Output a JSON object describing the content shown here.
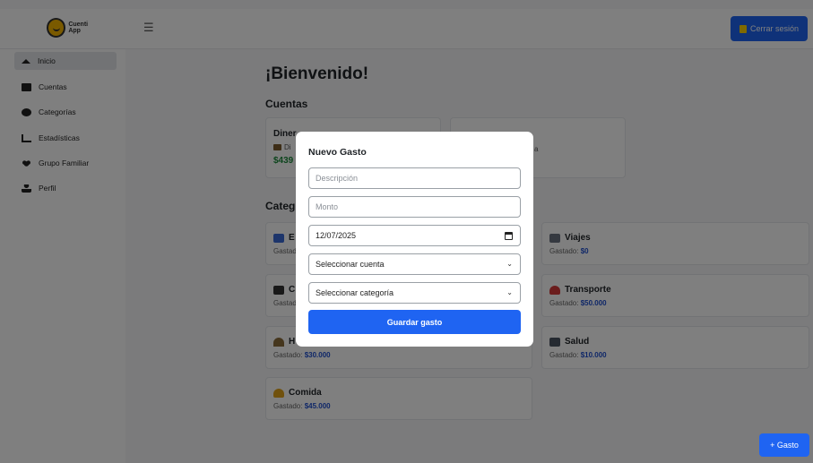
{
  "app": {
    "logo_text": "Cuenti App"
  },
  "header": {
    "menu_icon": "hamburger-icon",
    "logout_label": "Cerrar sesión",
    "logout_icon": "logout-icon"
  },
  "sidebar": {
    "items": [
      {
        "label": "Inicio",
        "icon": "home-icon"
      },
      {
        "label": "Cuentas",
        "icon": "card-icon"
      },
      {
        "label": "Categorías",
        "icon": "pie-icon"
      },
      {
        "label": "Estadísticas",
        "icon": "chart-icon"
      },
      {
        "label": "Grupo Familiar",
        "icon": "users-icon"
      },
      {
        "label": "Perfil",
        "icon": "user-icon"
      }
    ]
  },
  "main": {
    "welcome": "¡Bienvenido!",
    "accounts_heading": "Cuentas",
    "accounts": [
      {
        "title": "Diner",
        "sub": "Di",
        "amount": "$439"
      },
      {
        "title": "",
        "sub": "a",
        "amount": ""
      }
    ],
    "categories_heading": "Categ",
    "categories": [
      {
        "name": "E",
        "spent_label": "Gastad",
        "spent": ""
      },
      {
        "name": "Viajes",
        "spent_label": "Gastado:",
        "spent": "$0"
      },
      {
        "name": "C",
        "spent_label": "Gastad",
        "spent": ""
      },
      {
        "name": "Transporte",
        "spent_label": "Gastado:",
        "spent": "$50.000"
      },
      {
        "name": "H",
        "spent_label": "Gastado:",
        "spent": "$30.000"
      },
      {
        "name": "Salud",
        "spent_label": "Gastado:",
        "spent": "$10.000"
      },
      {
        "name": "Comida",
        "spent_label": "Gastado:",
        "spent": "$45.000"
      }
    ]
  },
  "modal": {
    "title": "Nuevo Gasto",
    "description_placeholder": "Descripción",
    "amount_placeholder": "Monto",
    "date_value": "12/07/2025",
    "account_select": "Seleccionar cuenta",
    "category_select": "Seleccionar categoría",
    "save_label": "Guardar gasto"
  },
  "fab": {
    "label": "+ Gasto"
  },
  "colors": {
    "primary": "#1f64f2",
    "amount_green": "#1a8a3a",
    "overlay": "rgba(0,0,0,0.5)"
  }
}
